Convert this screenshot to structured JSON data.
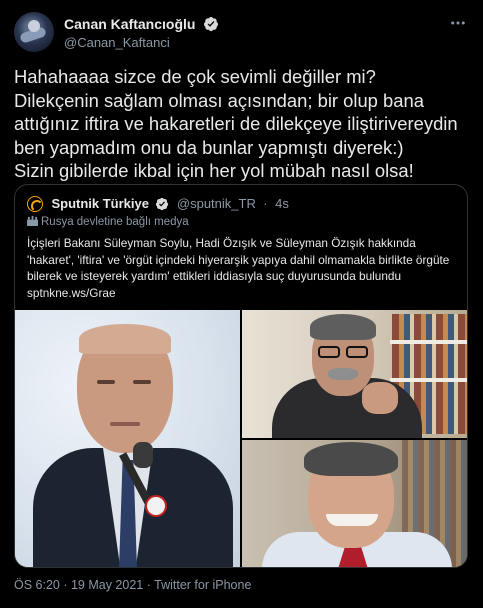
{
  "author": {
    "display_name": "Canan Kaftancıoğlu",
    "handle": "@Canan_Kaftanci"
  },
  "tweet": {
    "text": "Hahahaaaa sizce de çok sevimli değiller mi?\nDilekçenin sağlam olması açısından; bir olup bana attığınız iftira ve hakaretleri de dilekçeye iliştirivereydin ben yapmadım onu da bunlar yapmıştı diyerek:)\nSizin gibilerde ikbal için her yol mübah nasıl olsa!"
  },
  "quoted_tweet": {
    "display_name": "Sputnik Türkiye",
    "handle": "@sputnik_TR",
    "separator": "·",
    "time": "4s",
    "state_media_label": "Rusya devletine bağlı medya",
    "text": "İçişleri Bakanı Süleyman Soylu, Hadi Özışık ve Süleyman Özışık hakkında 'hakaret', 'iftira' ve 'örgüt içindeki hiyerarşik yapıya dahil olmamakla birlikte örgüte bilerek ve isteyerek yardım' ettikleri iddiasıyla suç duyurusunda bulundu sptnkne.ws/Grae"
  },
  "footer": {
    "timestamp": "ÖS 6:20 · 19 May 2021 · Twitter for iPhone"
  },
  "icons": {
    "verified": "verified-badge-icon",
    "more": "more-options-icon",
    "state_media": "flag-icon"
  },
  "colors": {
    "background": "#000000",
    "text": "#e7e9ea",
    "secondary_text": "#8b98a5",
    "verified_badge": "#d9d9d9",
    "border": "#2f3336"
  }
}
